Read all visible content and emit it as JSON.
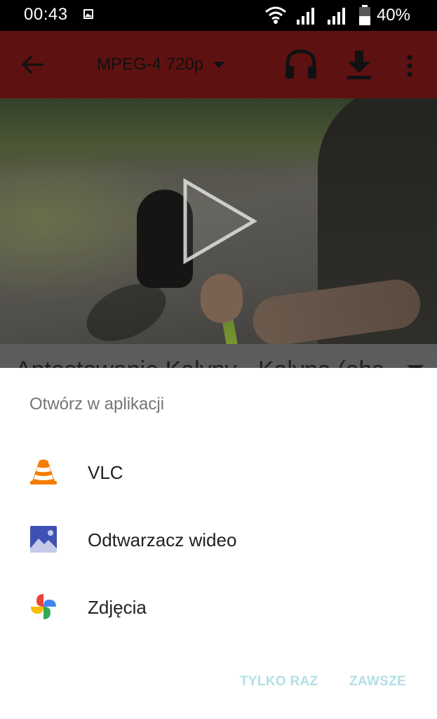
{
  "status_bar": {
    "time": "00:43",
    "battery_percent": "40%",
    "icons": [
      "image-icon",
      "wifi-icon",
      "signal-icon",
      "signal-icon",
      "battery-icon"
    ]
  },
  "toolbar": {
    "format_label": "MPEG-4 720p",
    "icons": [
      "back-arrow-icon",
      "dropdown-caret-icon",
      "headphones-icon",
      "download-icon",
      "more-vert-icon"
    ],
    "background_color": "#5e1111"
  },
  "video": {
    "play_icon": "play-icon"
  },
  "behind_text": "Antestowanie Kalyny - Kalyna (ohs",
  "sheet": {
    "title": "Otwórz w aplikacji",
    "apps": [
      {
        "label": "VLC",
        "icon": "vlc-cone-icon"
      },
      {
        "label": "Odtwarzacz wideo",
        "icon": "image-landscape-icon"
      },
      {
        "label": "Zdjęcia",
        "icon": "google-photos-pinwheel-icon"
      }
    ],
    "buttons": {
      "just_once": "TYLKO RAZ",
      "always": "ZAWSZE"
    },
    "button_color": "#b3dfe6"
  }
}
